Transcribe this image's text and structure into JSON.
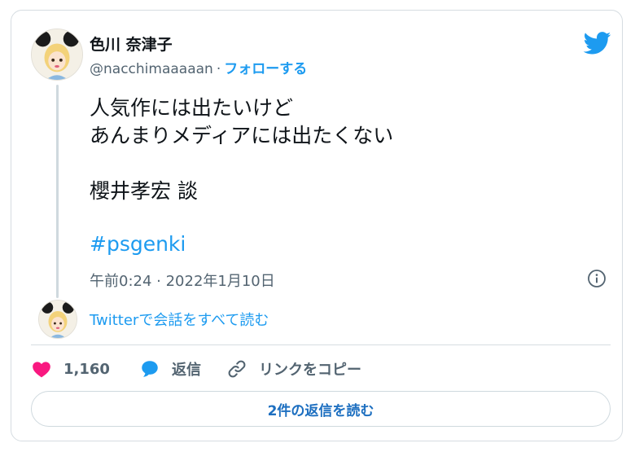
{
  "author": {
    "name": "色川 奈津子",
    "handle": "@nacchimaaaaan",
    "separator": "·",
    "follow_label": "フォローする"
  },
  "tweet": {
    "lines": [
      "人気作には出たいけど",
      "あんまりメディアには出たくない",
      "櫻井孝宏 談"
    ],
    "hashtag": "#psgenki",
    "timestamp": "午前0:24 · 2022年1月10日"
  },
  "thread_link": "Twitterで会話をすべて読む",
  "actions": {
    "like_count": "1,160",
    "reply_label": "返信",
    "copy_link_label": "リンクをコピー"
  },
  "replies_button": "2件の返信を読む",
  "colors": {
    "accent": "#1d9bf0",
    "like": "#f91880",
    "text": "#0f1419",
    "muted": "#536471",
    "border": "#d6dce1"
  },
  "icons": [
    "twitter-bird-icon",
    "info-icon",
    "heart-icon",
    "reply-bubble-icon",
    "link-icon"
  ]
}
